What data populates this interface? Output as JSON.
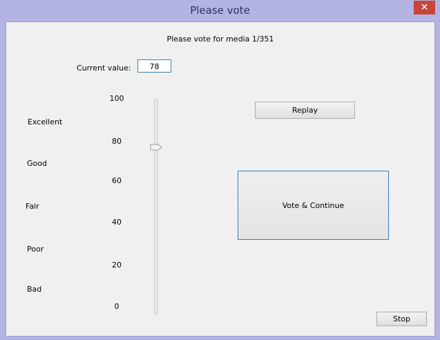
{
  "window": {
    "title": "Please vote",
    "close_icon": "✕"
  },
  "media": {
    "label": "Please vote for media 1/351"
  },
  "current": {
    "label": "Current value:",
    "value": "78"
  },
  "scale": {
    "ticks": [
      "100",
      "80",
      "60",
      "40",
      "20",
      "0"
    ],
    "qualities": [
      "Excellent",
      "Good",
      "Fair",
      "Poor",
      "Bad"
    ]
  },
  "slider": {
    "min": 0,
    "max": 100,
    "value": 78
  },
  "buttons": {
    "replay": "Replay",
    "vote": "Vote & Continue",
    "stop": "Stop"
  },
  "colors": {
    "frame": "#b4b4e4",
    "close": "#c7463a",
    "focus_border": "#3c7fb1"
  }
}
